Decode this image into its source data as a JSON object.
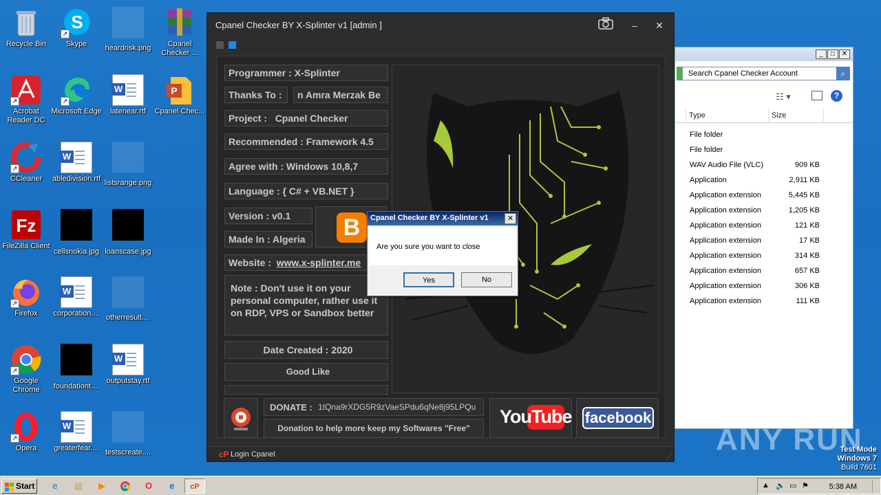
{
  "desktop": {
    "icons": [
      {
        "label": "Recycle Bin",
        "icon": "recycle-bin-icon"
      },
      {
        "label": "Skype",
        "icon": "skype-icon"
      },
      {
        "label": "heardrisk.png",
        "icon": "image-file-icon"
      },
      {
        "label": "Cpanel Checker ...",
        "icon": "winrar-icon"
      },
      {
        "label": "Acrobat Reader DC",
        "icon": "acrobat-icon"
      },
      {
        "label": "Microsoft Edge",
        "icon": "edge-icon"
      },
      {
        "label": "latenear.rtf",
        "icon": "word-doc-icon"
      },
      {
        "label": "Cpanel Chec...",
        "icon": "powerpoint-icon"
      },
      {
        "label": "CCleaner",
        "icon": "ccleaner-icon"
      },
      {
        "label": "abledivision.rtf",
        "icon": "word-doc-icon"
      },
      {
        "label": "listsrange.png",
        "icon": "image-file-icon"
      },
      {
        "label": "FileZilla Client",
        "icon": "filezilla-icon"
      },
      {
        "label": "cellsnokia.jpg",
        "icon": "image-file-icon"
      },
      {
        "label": "loanscase.jpg",
        "icon": "image-file-icon"
      },
      {
        "label": "Firefox",
        "icon": "firefox-icon"
      },
      {
        "label": "corporation....",
        "icon": "word-doc-icon"
      },
      {
        "label": "otherresult....",
        "icon": "image-file-icon"
      },
      {
        "label": "Google Chrome",
        "icon": "chrome-icon"
      },
      {
        "label": "foundationt....",
        "icon": "image-file-icon"
      },
      {
        "label": "outputstay.rtf",
        "icon": "word-doc-icon"
      },
      {
        "label": "Opera",
        "icon": "opera-icon"
      },
      {
        "label": "greaterfear....",
        "icon": "word-doc-icon"
      },
      {
        "label": "testscreate....",
        "icon": "image-file-icon"
      }
    ]
  },
  "app": {
    "title": "Cpanel Checker BY X-Splinter v1 [admin ]",
    "fields": {
      "programmer": "Programmer : X-Splinter",
      "thanks_label": "Thanks To :",
      "thanks_value": "n Amra Merzak Be",
      "project_label": "Project :",
      "project_value": "Cpanel Checker",
      "recommended": "Recommended : Framework 4.5",
      "agree": "Agree with : Windows 10,8,7",
      "language": "Language : { C# + VB.NET }",
      "version": "Version : v0.1",
      "made_in": "Made In : Algeria",
      "website_label": "Website :",
      "website_value": "www.x-splinter.me",
      "note": "Note : Don't use it on your personal computer, rather use it on RDP, VPS or Sandbox better",
      "date_created": "Date Created : 2020",
      "good_like": "Good Like"
    },
    "donate_label": "DONATE :",
    "donate_address": "1tQna9rXDG5R9zVaeSPdu6qNe8j95LPQu",
    "donation_text": "Donation to help more keep my Softwares \"Free\"",
    "youtube_text": "YouTube",
    "facebook_text": "facebook",
    "blogger_letter": "B",
    "status_text": "Login Cpanel"
  },
  "dialog": {
    "title": "Cpanel Checker BY X-Splinter v1",
    "message": "Are you sure you want to close",
    "yes": "Yes",
    "no": "No"
  },
  "explorer": {
    "search_placeholder": "Search Cpanel Checker Account",
    "col_type": "Type",
    "col_size": "Size",
    "rows": [
      {
        "type": "File folder",
        "size": ""
      },
      {
        "type": "File folder",
        "size": ""
      },
      {
        "type": "WAV Audio File (VLC)",
        "size": "909 KB"
      },
      {
        "type": "Application",
        "size": "2,911 KB"
      },
      {
        "type": "Application extension",
        "size": "5,445 KB"
      },
      {
        "type": "Application extension",
        "size": "1,205 KB"
      },
      {
        "type": "Application extension",
        "size": "121 KB"
      },
      {
        "type": "Application extension",
        "size": "17 KB"
      },
      {
        "type": "Application extension",
        "size": "314 KB"
      },
      {
        "type": "Application extension",
        "size": "657 KB"
      },
      {
        "type": "Application extension",
        "size": "306 KB"
      },
      {
        "type": "Application extension",
        "size": "111 KB"
      }
    ]
  },
  "taskbar": {
    "start": "Start",
    "clock": "5:38 AM"
  },
  "watermark": "ANY RUN",
  "testmode": {
    "line1": "Test Mode",
    "line2": "Windows 7",
    "line3": "Build 7601"
  }
}
